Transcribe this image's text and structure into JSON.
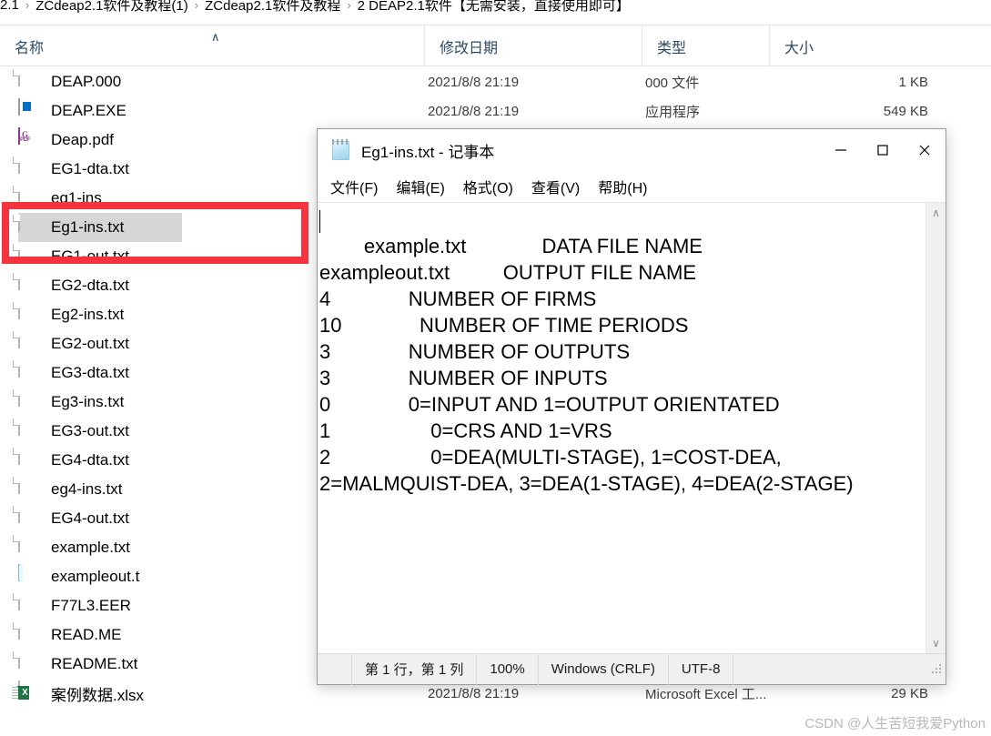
{
  "explorer": {
    "breadcrumb": {
      "separator": "›",
      "crumbs": [
        "2.1",
        "ZCdeap2.1软件及教程(1)",
        "ZCdeap2.1软件及教程",
        "2 DEAP2.1软件【无需安装，直接使用即可】"
      ]
    },
    "columns": [
      {
        "label": "名称",
        "sorted": true,
        "sort_icon": "∧"
      },
      {
        "label": "修改日期",
        "sorted": false
      },
      {
        "label": "类型",
        "sorted": false
      },
      {
        "label": "大小",
        "sorted": false
      }
    ],
    "files": [
      {
        "name": "DEAP.000",
        "icon": "blank-file-icon",
        "date": "2021/8/8 21:19",
        "type": "000 文件",
        "size": "1 KB",
        "selected": false
      },
      {
        "name": "DEAP.EXE",
        "icon": "application-icon",
        "date": "2021/8/8 21:19",
        "type": "应用程序",
        "size": "549 KB",
        "selected": false
      },
      {
        "name": "Deap.pdf",
        "icon": "pdf-file-icon",
        "date": "",
        "type": "",
        "size": "",
        "selected": false
      },
      {
        "name": "EG1-dta.txt",
        "icon": "text-file-icon",
        "date": "",
        "type": "",
        "size": "",
        "selected": false
      },
      {
        "name": "eg1-ins",
        "icon": "blank-file-icon",
        "date": "",
        "type": "",
        "size": "",
        "selected": false
      },
      {
        "name": "Eg1-ins.txt",
        "icon": "text-file-icon",
        "date": "",
        "type": "",
        "size": "",
        "selected": true
      },
      {
        "name": "EG1-out.txt",
        "icon": "text-file-icon",
        "date": "",
        "type": "",
        "size": "",
        "selected": false
      },
      {
        "name": "EG2-dta.txt",
        "icon": "text-file-icon",
        "date": "",
        "type": "",
        "size": "",
        "selected": false
      },
      {
        "name": "Eg2-ins.txt",
        "icon": "text-file-icon",
        "date": "",
        "type": "",
        "size": "",
        "selected": false
      },
      {
        "name": "EG2-out.txt",
        "icon": "text-file-icon",
        "date": "",
        "type": "",
        "size": "",
        "selected": false
      },
      {
        "name": "EG3-dta.txt",
        "icon": "text-file-icon",
        "date": "",
        "type": "",
        "size": "",
        "selected": false
      },
      {
        "name": "Eg3-ins.txt",
        "icon": "text-file-icon",
        "date": "",
        "type": "",
        "size": "",
        "selected": false
      },
      {
        "name": "EG3-out.txt",
        "icon": "text-file-icon",
        "date": "",
        "type": "",
        "size": "",
        "selected": false
      },
      {
        "name": "EG4-dta.txt",
        "icon": "text-file-icon",
        "date": "",
        "type": "",
        "size": "",
        "selected": false
      },
      {
        "name": "eg4-ins.txt",
        "icon": "text-file-icon",
        "date": "",
        "type": "",
        "size": "",
        "selected": false
      },
      {
        "name": "EG4-out.txt",
        "icon": "text-file-icon",
        "date": "",
        "type": "",
        "size": "",
        "selected": false
      },
      {
        "name": "example.txt",
        "icon": "text-file-icon",
        "date": "",
        "type": "",
        "size": "",
        "selected": false
      },
      {
        "name": "exampleout.t",
        "icon": "wordpad-file-icon",
        "date": "",
        "type": "",
        "size": "",
        "selected": false
      },
      {
        "name": "F77L3.EER",
        "icon": "blank-file-icon",
        "date": "",
        "type": "",
        "size": "",
        "selected": false
      },
      {
        "name": "READ.ME",
        "icon": "blank-file-icon",
        "date": "",
        "type": "",
        "size": "",
        "selected": false
      },
      {
        "name": "README.txt",
        "icon": "text-file-icon",
        "date": "",
        "type": "",
        "size": "",
        "selected": false
      },
      {
        "name": "案例数据.xlsx",
        "icon": "excel-file-icon",
        "date": "2021/8/8 21:19",
        "type": "Microsoft Excel 工...",
        "size": "29 KB",
        "selected": false
      }
    ]
  },
  "annotation": {
    "color": "#f5333f",
    "target": "Eg1-ins.txt"
  },
  "notepad": {
    "icon": "notepad-icon",
    "title": "Eg1-ins.txt - 记事本",
    "window_buttons": {
      "minimize": "minimize-icon",
      "maximize": "maximize-icon",
      "close": "close-icon"
    },
    "menu": [
      "文件(F)",
      "编辑(E)",
      "格式(O)",
      "查看(V)",
      "帮助(H)"
    ],
    "content": "example.txt\t\tDATA FILE NAME\nexampleout.txt\t\t OUTPUT FILE NAME\n4\t\tNUMBER OF FIRMS\n10\t\t  NUMBER OF TIME PERIODS\n3\t\tNUMBER OF OUTPUTS\n3\t\tNUMBER OF INPUTS\n0\t\t0=INPUT AND 1=OUTPUT ORIENTATED\n1\t\t    0=CRS AND 1=VRS\n2\t\t    0=DEA(MULTI-STAGE), 1=COST-DEA, 2=MALMQUIST-DEA, 3=DEA(1-STAGE), 4=DEA(2-STAGE)",
    "scrollbar": {
      "up": "∧",
      "down": "∨"
    },
    "status": {
      "position": "第 1 行，第 1 列",
      "zoom": "100%",
      "line_ending": "Windows (CRLF)",
      "encoding": "UTF-8"
    }
  },
  "watermark": "CSDN @人生苦短我爱Python"
}
